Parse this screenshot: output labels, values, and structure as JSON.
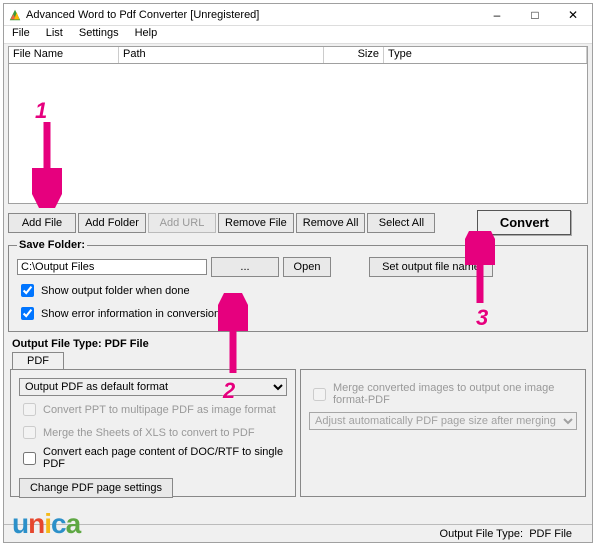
{
  "annotations": {
    "one": "1",
    "two": "2",
    "three": "3"
  },
  "titlebar": {
    "title": "Advanced Word to Pdf Converter [Unregistered]"
  },
  "menu": {
    "file": "File",
    "list": "List",
    "settings": "Settings",
    "help": "Help"
  },
  "columns": {
    "filename": "File Name",
    "path": "Path",
    "size": "Size",
    "type": "Type"
  },
  "buttons": {
    "addfile": "Add File",
    "addfolder": "Add Folder",
    "addurl": "Add URL",
    "removefile": "Remove File",
    "removeall": "Remove All",
    "selectall": "Select All",
    "convert": "Convert"
  },
  "savefolder": {
    "legend": "Save Folder:",
    "path": "C:\\Output Files",
    "browse": "...",
    "open": "Open",
    "setname": "Set output file name",
    "showfolder": "Show output folder when done",
    "showerror": "Show error information in conversion"
  },
  "output": {
    "title": "Output File Type:  PDF File",
    "tab": "PDF",
    "select1": "Output PDF as default format",
    "opt_ppt": "Convert PPT to multipage PDF as image format",
    "opt_merge": "Merge the Sheets of XLS to convert to PDF",
    "opt_doc": "Convert each page content of DOC/RTF to single PDF",
    "change": "Change PDF page settings",
    "opt_mergeimg": "Merge converted images to output one image format-PDF",
    "select2": "Adjust automatically PDF page size after merging images to PDF"
  },
  "status": {
    "label": "Output File Type:",
    "value": "PDF File"
  },
  "watermark": "unica"
}
